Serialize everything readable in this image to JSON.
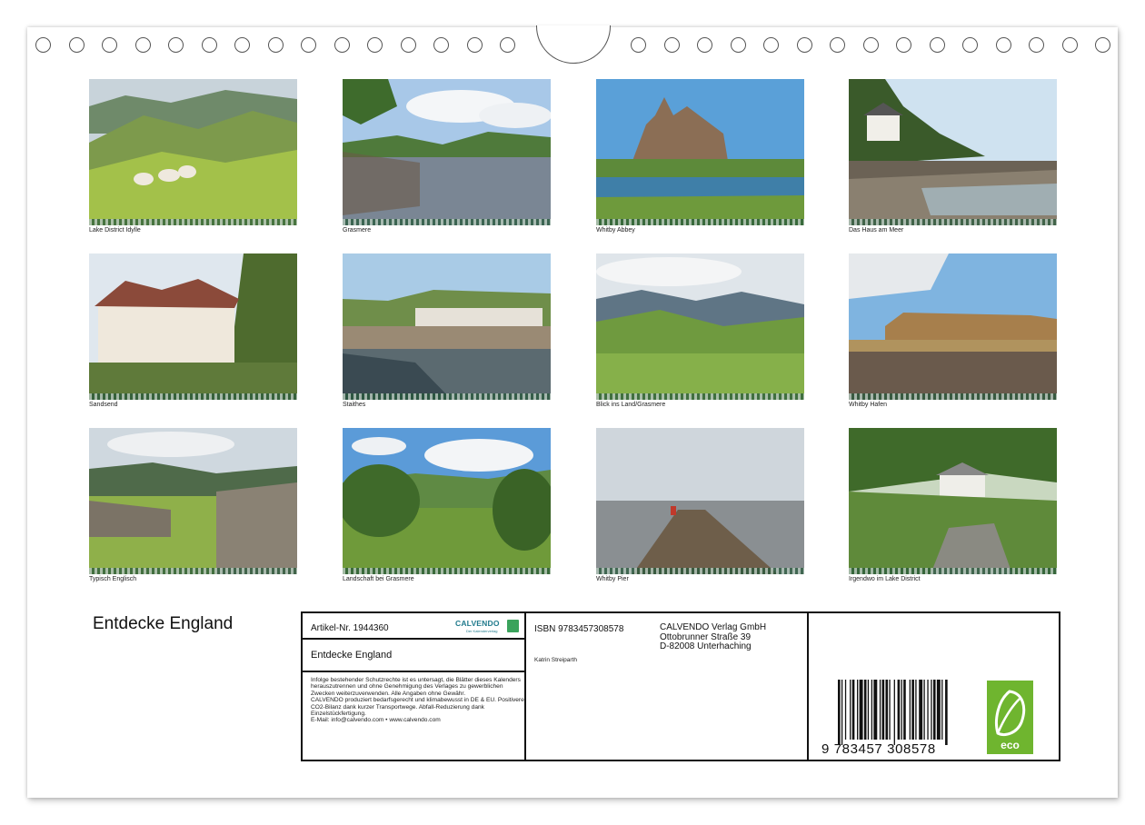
{
  "title": "Entdecke England",
  "months": [
    {
      "caption": "Lake District Idylle",
      "scene": "sheep-hills"
    },
    {
      "caption": "Grasmere",
      "scene": "lake-fence"
    },
    {
      "caption": "Whitby Abbey",
      "scene": "abbey"
    },
    {
      "caption": "Das Haus am Meer",
      "scene": "house-sea"
    },
    {
      "caption": "Sandsend",
      "scene": "cottages"
    },
    {
      "caption": "Staithes",
      "scene": "harbour-village"
    },
    {
      "caption": "Blick ins Land/Grasmere",
      "scene": "valley"
    },
    {
      "caption": "Whitby Hafen",
      "scene": "whitby-harbour"
    },
    {
      "caption": "Typisch Englisch",
      "scene": "stone-wall"
    },
    {
      "caption": "Landschaft bei Grasmere",
      "scene": "green-trees"
    },
    {
      "caption": "Whitby Pier",
      "scene": "pier"
    },
    {
      "caption": "Irgendwo im Lake District",
      "scene": "cottage-forest"
    }
  ],
  "info": {
    "article": "Artikel-Nr. 1944360",
    "logo_text": "CALVENDO",
    "logo_sub": "Der Kalenderverlag",
    "title": "Entdecke England",
    "legal": "Infolge bestehender Schutzrechte ist es untersagt, die Blätter dieses Kalenders herauszutrennen und ohne Genehmigung des Verlages zu gewerblichen Zwecken weiterzuverwenden. Alle Angaben ohne Gewähr.\nCALVENDO produziert bedarfsgerecht und klimabewusst in DE & EU. Positivere CO2-Bilanz dank kurzer Transportwege. Abfall-Reduzierung dank Einzelstückfertigung.\nE-Mail: info@calvendo.com • www.calvendo.com",
    "isbn": "ISBN 9783457308578",
    "publisher_lines": [
      "CALVENDO Verlag GmbH",
      "Ottobrunner Straße 39",
      "D-82008 Unterhaching"
    ],
    "author": "Katrin Streiparth",
    "barcode_number": "9  783457  308578",
    "eco_label": "eco"
  },
  "colors": {
    "ring": "#555555",
    "eco": "#6fb52f",
    "logo": "#1f7a8c"
  }
}
